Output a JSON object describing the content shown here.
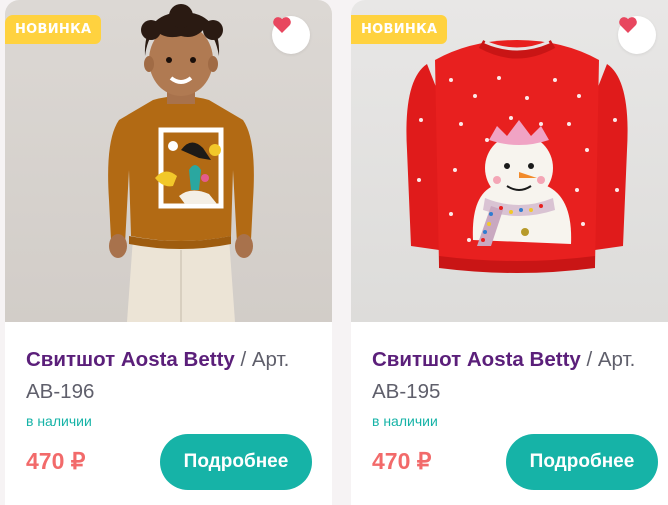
{
  "products": [
    {
      "badge": "НОВИНКА",
      "name": "Свитшот Aosta Betty",
      "sku_sep": " / Арт. ",
      "sku": "AB-196",
      "stock": "в наличии",
      "price": "470 ₽",
      "button": "Подробнее",
      "photo": "boy-in-brown-dinosaur-sweatshirt",
      "favorite_icon": "heart-icon"
    },
    {
      "badge": "НОВИНКА",
      "name": "Свитшот Aosta Betty",
      "sku_sep": " / Арт. ",
      "sku": "AB-195",
      "stock": "в наличии",
      "price": "470 ₽",
      "button": "Подробнее",
      "photo": "red-snowman-sweatshirt",
      "favorite_icon": "heart-icon"
    }
  ],
  "colors": {
    "badge": "#ffd23f",
    "title": "#5b1f7a",
    "accent": "#16b3a7",
    "price": "#f26a6a",
    "heart": "#e8475f"
  }
}
